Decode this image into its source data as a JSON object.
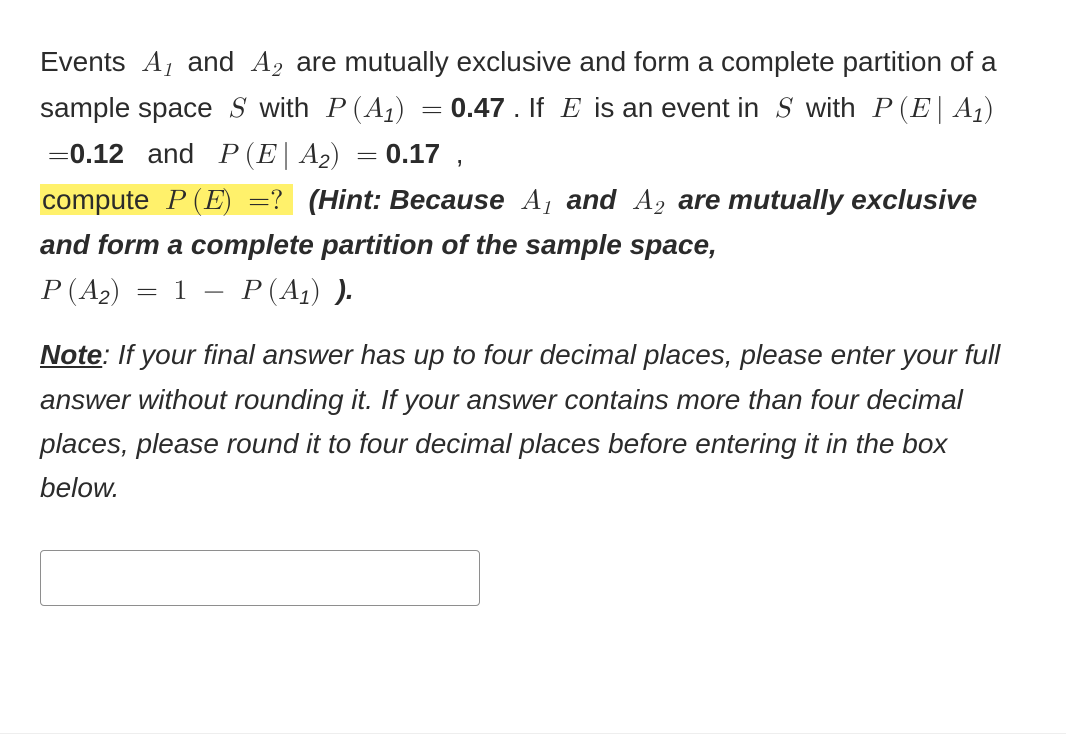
{
  "question": {
    "t1": "Events",
    "A1": "A",
    "sub1": "1",
    "t2": "and",
    "A2": "A",
    "sub2": "2",
    "t3": "are mutually exclusive and form a complete partition of a sample space",
    "S": "S",
    "t4": "with",
    "P": "P",
    "lp": "(",
    "rp": ")",
    "eq": "=",
    "pA1": "0.47",
    "t5": ".  If",
    "E": "E",
    "t6": "is an event in",
    "t7": "with",
    "bar": "∣",
    "pEa1": "0.12",
    "t8": "and",
    "pEa2": "0.17",
    "t9": ",",
    "hl_compute": "compute",
    "hl_q": "?",
    "hint_open": "(Hint: Because",
    "hint_mid": "and",
    "hint_tail": "are mutually exclusive and form a complete partition of the sample space,",
    "one": "1",
    "minus": "−",
    "hint_end": ").",
    "note_label": "Note",
    "note_text": ": If your final answer has up to four decimal places, please enter your full answer without rounding it. If your answer contains more than four decimal places, please round it to four decimal places before entering it in the box below."
  },
  "input": {
    "value": "",
    "placeholder": ""
  }
}
